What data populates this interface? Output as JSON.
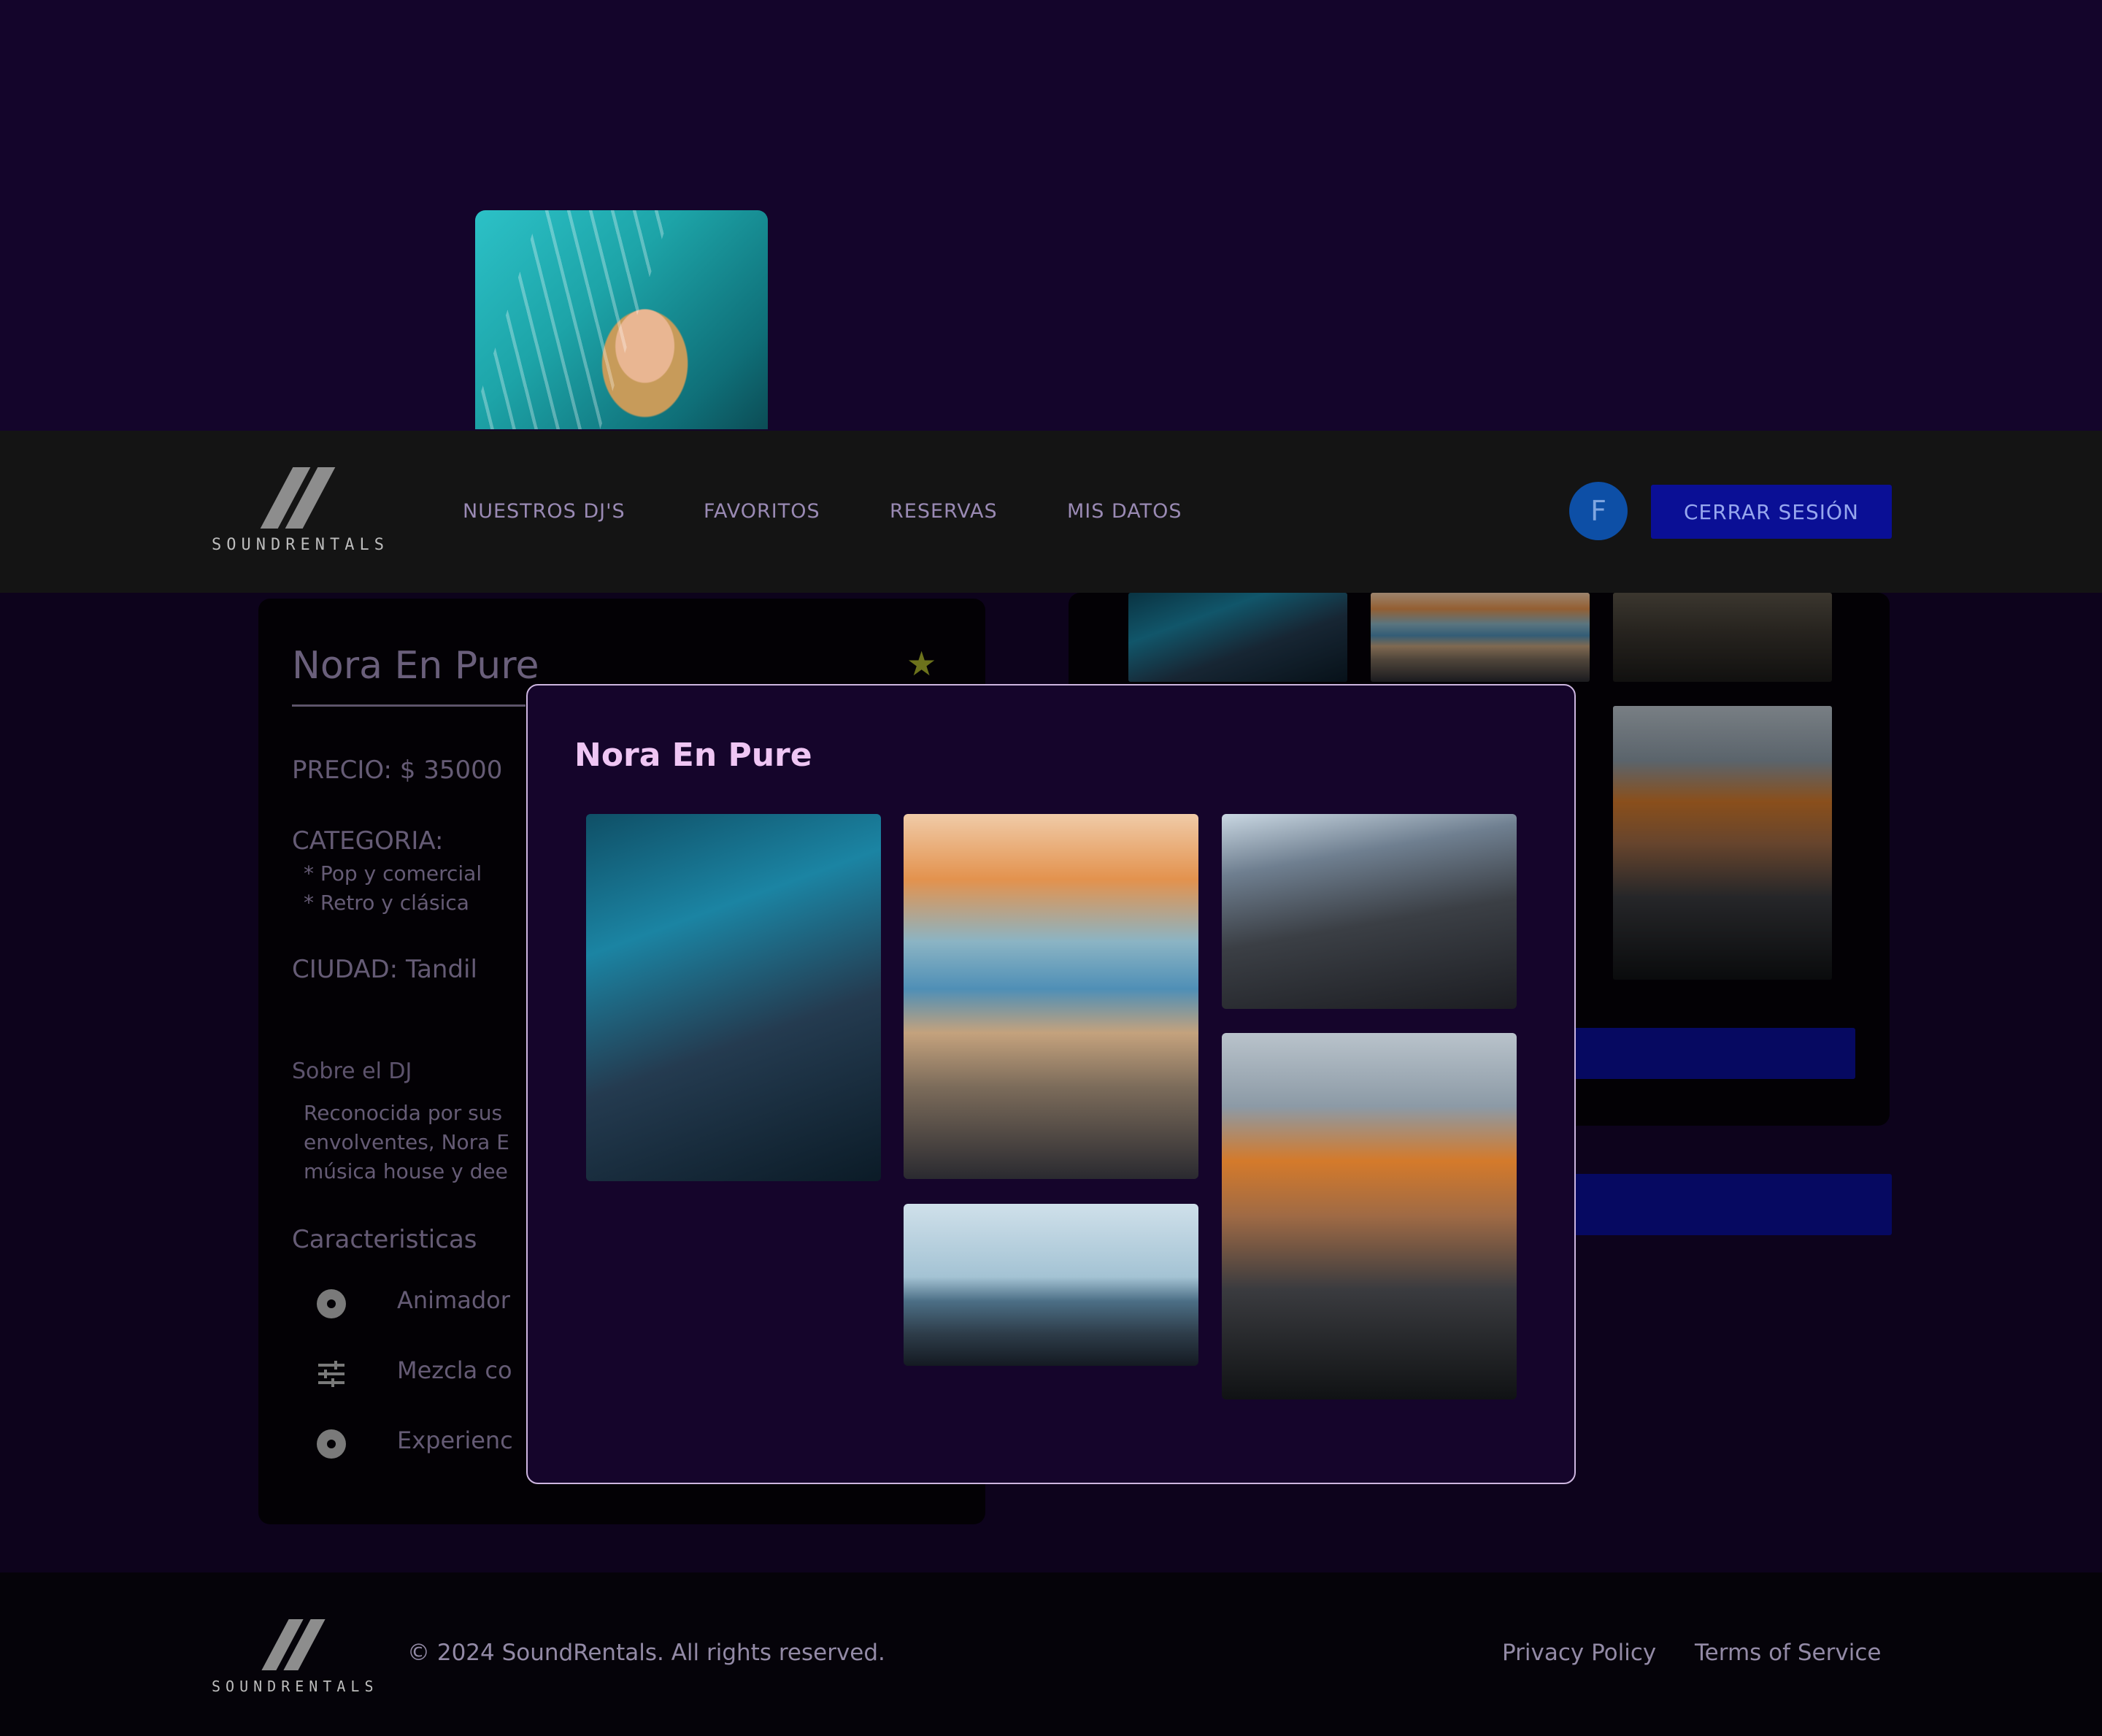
{
  "hero": {
    "photo_alt": "DJ portrait on stage"
  },
  "brand": {
    "name": "SOUNDRENTALS"
  },
  "nav": {
    "links": [
      "NUESTROS DJ'S",
      "FAVORITOS",
      "RESERVAS",
      "MIS DATOS"
    ],
    "avatar_initial": "F",
    "logout_label": "CERRAR SESIÓN"
  },
  "dj": {
    "name": "Nora En Pure",
    "favorite_icon": "star-icon",
    "price": "PRECIO: $ 35000",
    "category_label": "CATEGORIA:",
    "categories": [
      "* Pop y comercial",
      "* Retro y clásica"
    ],
    "city": "CIUDAD: Tandil",
    "about_label": "Sobre el DJ",
    "about_lines": [
      "Reconocida por sus",
      "envolventes, Nora E",
      "música house y dee"
    ],
    "features_label": "Caracteristicas",
    "features": [
      {
        "icon": "disc-icon",
        "text": "Animador"
      },
      {
        "icon": "sliders-icon",
        "text": "Mezcla co"
      },
      {
        "icon": "disc-icon",
        "text": "Experienc"
      }
    ]
  },
  "modal": {
    "title": "Nora En Pure"
  },
  "footer": {
    "copyright": "© 2024 SoundRentals. All rights reserved.",
    "links": [
      "Privacy Policy",
      "Terms of Service"
    ]
  },
  "colors": {
    "background": "#14052b",
    "navbar": "#141414",
    "accent_button": "#0a0f95",
    "modal_title": "#efc6f4",
    "star": "#a6b02c"
  }
}
